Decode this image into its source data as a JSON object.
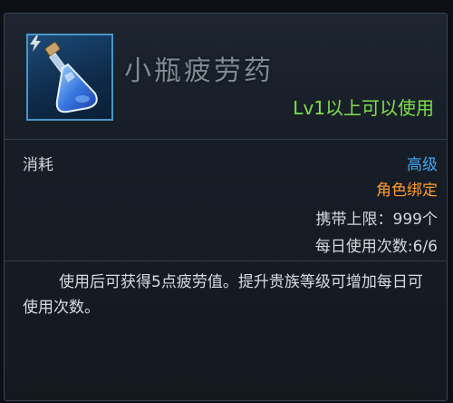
{
  "item": {
    "name": "小瓶疲劳药",
    "level_requirement": "Lv1以上可以使用",
    "icon": "potion-bottle-icon"
  },
  "stats": {
    "consume_label": "消耗",
    "grade": "高级",
    "binding": "角色绑定",
    "carry_limit": "携带上限：999个",
    "daily_uses": "每日使用次数:6/6"
  },
  "description": "使用后可获得5点疲劳值。提升贵族等级可增加每日可使用次数。",
  "colors": {
    "level_requirement": "#7ee04a",
    "grade": "#3fa6f0",
    "binding": "#ff9a2e",
    "icon_border": "#4a96c8"
  }
}
